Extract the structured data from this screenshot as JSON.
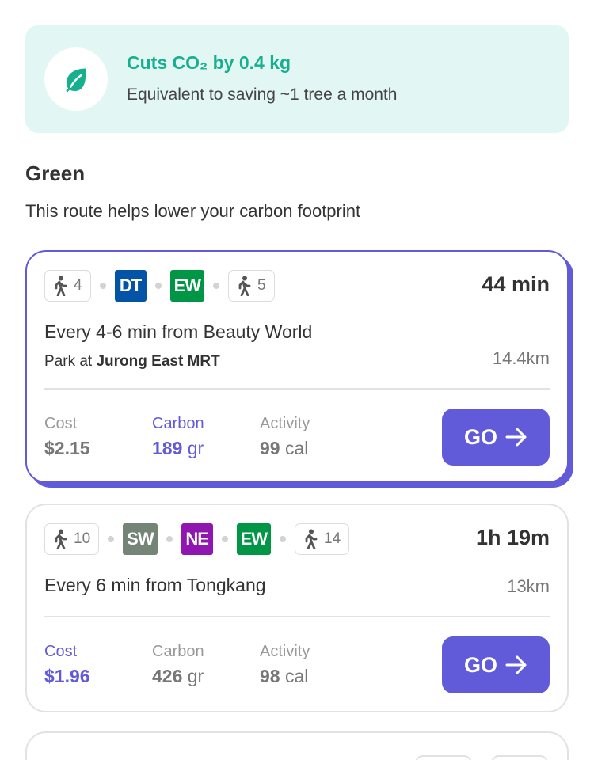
{
  "banner": {
    "icon": "leaf-icon",
    "title": "Cuts CO₂ by 0.4 kg",
    "subtitle": "Equivalent to saving ~1 tree a month",
    "accent": "#17b08e",
    "bg": "#e2f6f3"
  },
  "section": {
    "title": "Green",
    "subtitle": "This route helps lower your carbon footprint"
  },
  "routes": [
    {
      "walk_start": "4",
      "lines": [
        {
          "code": "DT",
          "color": "#0354a6"
        },
        {
          "code": "EW",
          "color": "#009645"
        }
      ],
      "walk_end": "5",
      "duration": "44 min",
      "frequency": "Every 4-6 min from Beauty World",
      "park_prefix": "Park at",
      "park_location": "Jurong East MRT",
      "distance": "14.4km",
      "cost_label": "Cost",
      "cost_value": "$2.15",
      "carbon_label": "Carbon",
      "carbon_value": "189",
      "carbon_unit": "gr",
      "activity_label": "Activity",
      "activity_value": "99",
      "activity_unit": "cal",
      "go_label": "GO",
      "highlighted_stat": "carbon",
      "selected": true
    },
    {
      "walk_start": "10",
      "lines": [
        {
          "code": "SW",
          "color": "#748477"
        },
        {
          "code": "NE",
          "color": "#9016b2"
        },
        {
          "code": "EW",
          "color": "#009645"
        }
      ],
      "walk_end": "14",
      "duration": "1h 19m",
      "frequency": "Every 6 min from Tongkang",
      "distance": "13km",
      "cost_label": "Cost",
      "cost_value": "$1.96",
      "carbon_label": "Carbon",
      "carbon_value": "426",
      "carbon_unit": "gr",
      "activity_label": "Activity",
      "activity_value": "98",
      "activity_unit": "cal",
      "go_label": "GO",
      "highlighted_stat": "cost",
      "selected": false
    }
  ],
  "colors": {
    "primary": "#625bd9",
    "walk_icon": "#555555"
  }
}
